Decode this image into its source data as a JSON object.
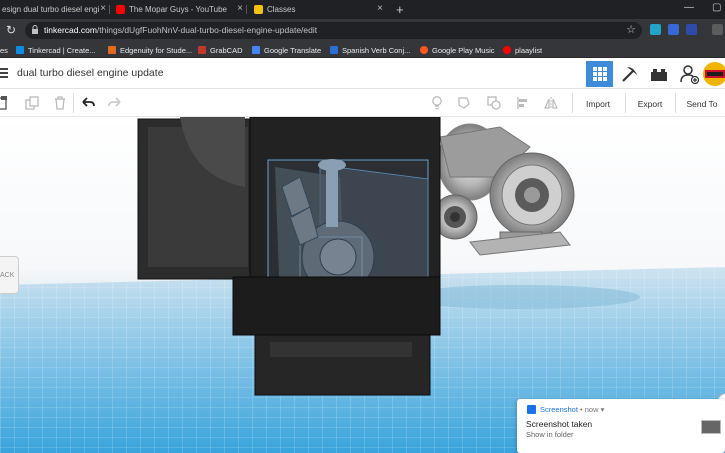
{
  "browser": {
    "tabs": [
      {
        "title": "esign dual turbo diesel engi",
        "icon_color": "#0b8de3",
        "active": false
      },
      {
        "title": "The Mopar Guys - YouTube",
        "icon_color": "#ff0000",
        "active": false
      },
      {
        "title": "Classes",
        "icon_color": "#f4c20d",
        "active": false
      }
    ],
    "new_tab_glyph": "+",
    "url_host": "tinkercad.com",
    "url_path": "/things/dUgfFuohNnV-dual-turbo-diesel-engine-update/edit"
  },
  "bookmarks": [
    {
      "label": "es",
      "icon": "none",
      "color": "#35363a"
    },
    {
      "label": "Tinkercad | Create...",
      "icon": "tinkercad-icon",
      "color": "#0b8de3"
    },
    {
      "label": "Edgenuity for Stude...",
      "icon": "edgenuity-icon",
      "color": "#e36b1f"
    },
    {
      "label": "GrabCAD",
      "icon": "grabcad-icon",
      "color": "#c0392b"
    },
    {
      "label": "Google Translate",
      "icon": "translate-icon",
      "color": "#4285f4"
    },
    {
      "label": "Spanish Verb Conj...",
      "icon": "spanish-icon",
      "color": "#2b6fd6"
    },
    {
      "label": "Google Play Music",
      "icon": "play-music-icon",
      "color": "#ff5722"
    },
    {
      "label": "plaaylist",
      "icon": "youtube-icon",
      "color": "#ff0000"
    }
  ],
  "tinkercad": {
    "design_title": "dual turbo diesel engine update",
    "buttons": {
      "import": "Import",
      "export": "Export",
      "send_to": "Send To"
    },
    "view_cube_label": "ACK",
    "accent": "#3d8bd9"
  },
  "notification": {
    "app": "Screenshot",
    "time": " • now",
    "chevron": " ▾",
    "title": "Screenshot taken",
    "body": "Show in folder"
  }
}
